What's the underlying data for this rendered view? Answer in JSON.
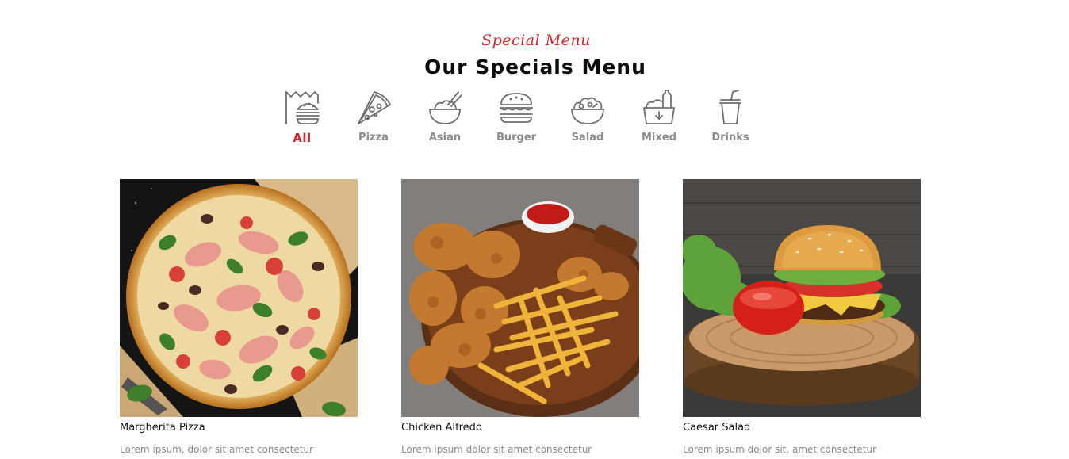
{
  "section": {
    "eyebrow": "Special Menu",
    "title": "Our Specials Menu"
  },
  "categories": [
    {
      "label": "All",
      "icon": "all-food-icon",
      "active": true
    },
    {
      "label": "Pizza",
      "icon": "pizza-slice-icon",
      "active": false
    },
    {
      "label": "Asian",
      "icon": "rice-bowl-chopsticks-icon",
      "active": false
    },
    {
      "label": "Burger",
      "icon": "burger-icon",
      "active": false
    },
    {
      "label": "Salad",
      "icon": "salad-bowl-icon",
      "active": false
    },
    {
      "label": "Mixed",
      "icon": "mixed-basket-icon",
      "active": false
    },
    {
      "label": "Drinks",
      "icon": "drink-cup-icon",
      "active": false
    }
  ],
  "items": [
    {
      "name": "Margherita Pizza",
      "description": "Lorem ipsum, dolor sit amet consectetur",
      "image": "pizza-photo"
    },
    {
      "name": "Chicken Alfredo",
      "description": "Lorem ipsum dolor sit amet consectetur",
      "image": "fried-chicken-fries-photo"
    },
    {
      "name": "Caesar Salad",
      "description": "Lorem ipsum dolor sit, amet consectetur",
      "image": "burger-photo"
    }
  ],
  "colors": {
    "accent": "#d0242b",
    "muted": "#8c8c8c",
    "heading": "#0c0c0c"
  }
}
